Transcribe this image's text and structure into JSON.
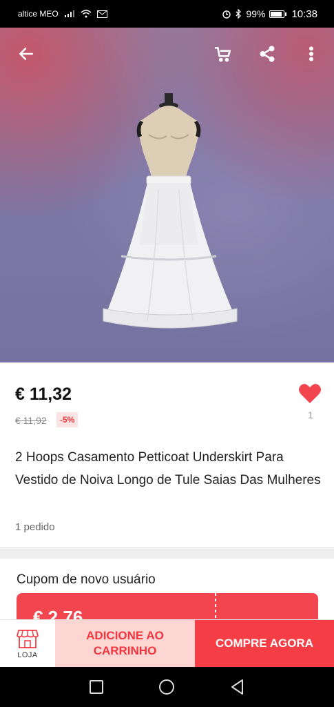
{
  "status_bar": {
    "carrier": "altice MEO",
    "battery": "99%",
    "time": "10:38"
  },
  "icons": {
    "back": "arrow-left-icon",
    "cart": "shopping-cart-icon",
    "share": "share-icon",
    "more": "more-vertical-icon",
    "wishlist": "heart-icon",
    "store": "store-icon"
  },
  "product": {
    "price": "€ 11,32",
    "original_price": "€ 11,92",
    "discount": "-5%",
    "wishlist_count": "1",
    "title": "2 Hoops Casamento Petticoat Underskirt Para Vestido de Noiva Longo de Tule Saias Das Mulheres",
    "orders": "1 pedido"
  },
  "coupon": {
    "title": "Cupom de novo usuário",
    "amount": "€ 2,76"
  },
  "action_bar": {
    "store_label": "LOJA",
    "add_to_cart": "ADICIONE AO CARRINHO",
    "buy_now": "COMPRE AGORA"
  },
  "colors": {
    "accent": "#f53d45",
    "accent_light": "#fdd6d4",
    "heart": "#f2454d"
  }
}
